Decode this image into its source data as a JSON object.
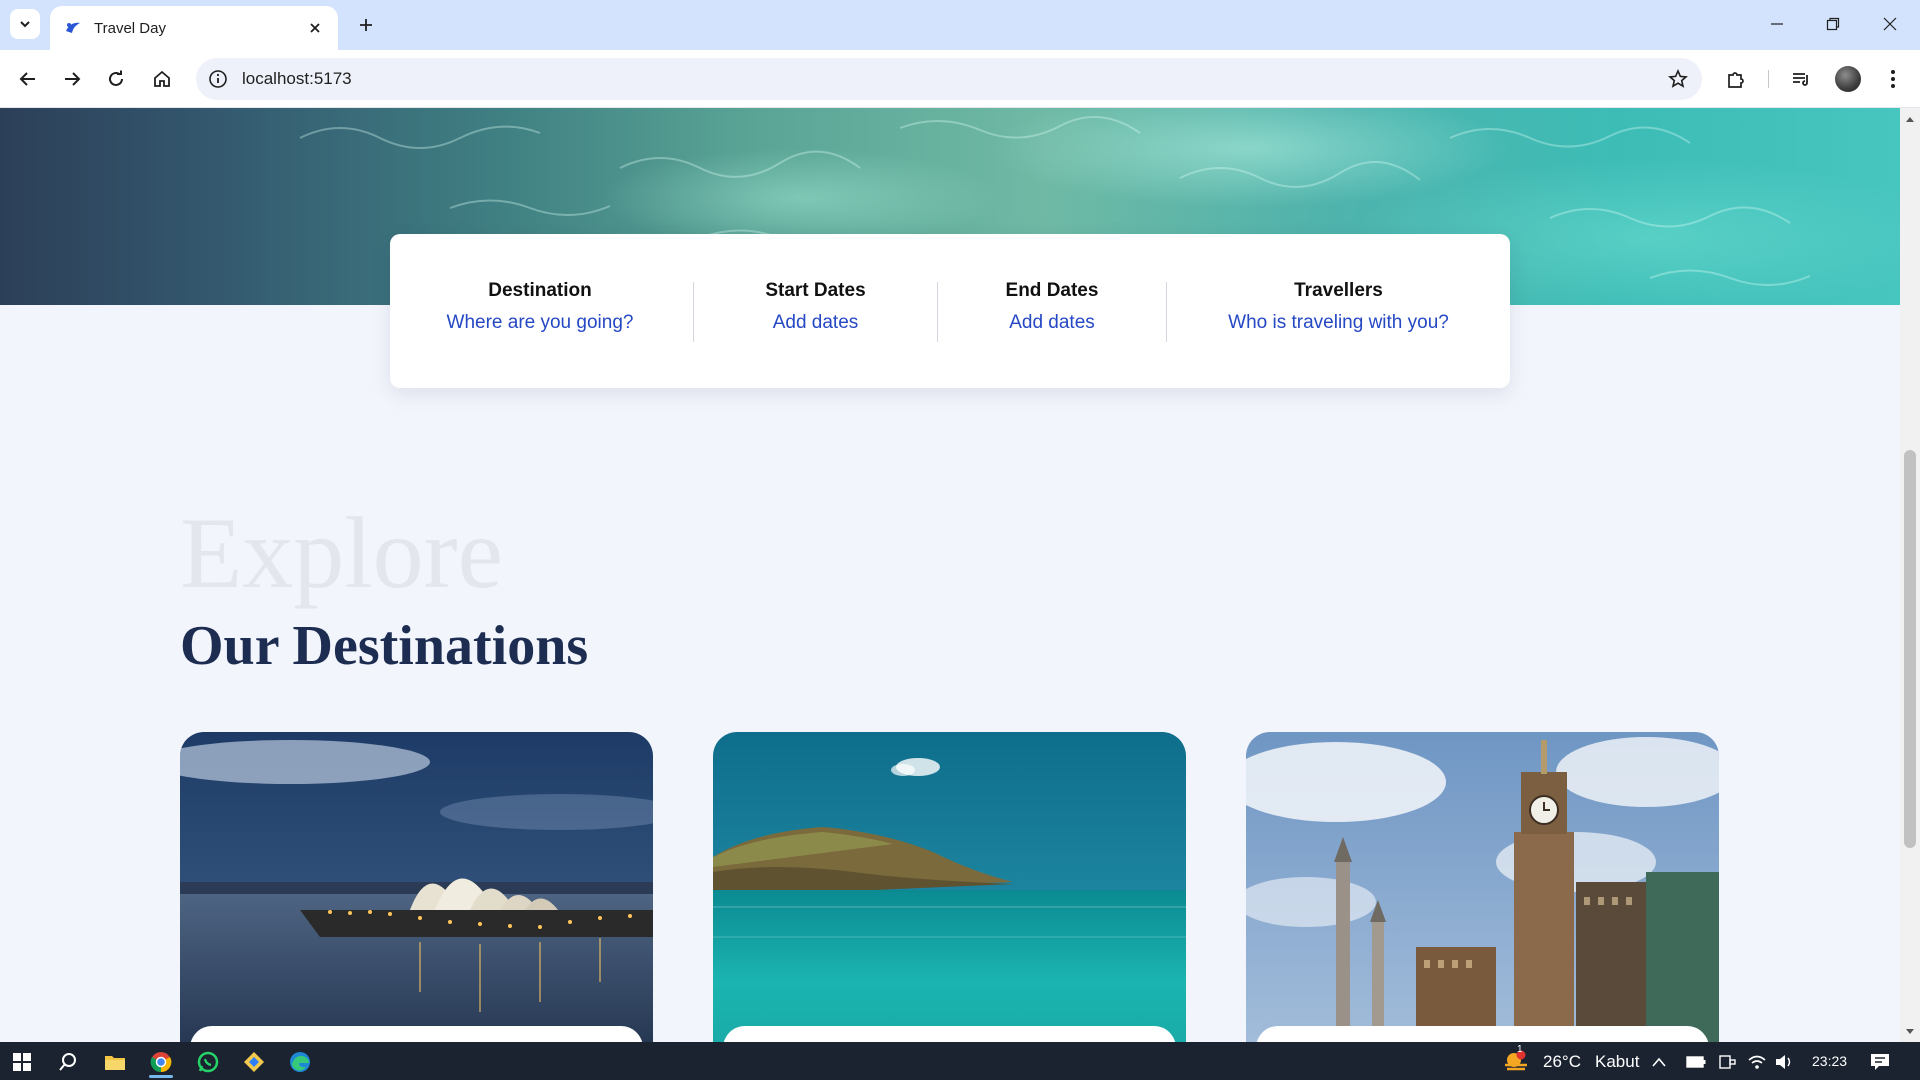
{
  "browser": {
    "tab_title": "Travel Day",
    "url": "localhost:5173"
  },
  "search_bar": {
    "fields": [
      {
        "label": "Destination",
        "value": "Where are you going?"
      },
      {
        "label": "Start Dates",
        "value": "Add dates"
      },
      {
        "label": "End Dates",
        "value": "Add dates"
      },
      {
        "label": "Travellers",
        "value": "Who is traveling with you?"
      }
    ]
  },
  "section": {
    "kicker": "Explore",
    "title": "Our Destinations"
  },
  "destination_cards": [
    {
      "image": "sydney-opera-house-night"
    },
    {
      "image": "tropical-island-turquoise-sea"
    },
    {
      "image": "mecca-clock-tower"
    }
  ],
  "taskbar": {
    "weather_temp": "26°C",
    "weather_desc": "Kabut",
    "weather_badge": "1",
    "time": "23:23"
  },
  "colors": {
    "accent_link": "#2548c4",
    "heading_dark": "#1d2d52",
    "page_bg": "#f3f5fc"
  }
}
